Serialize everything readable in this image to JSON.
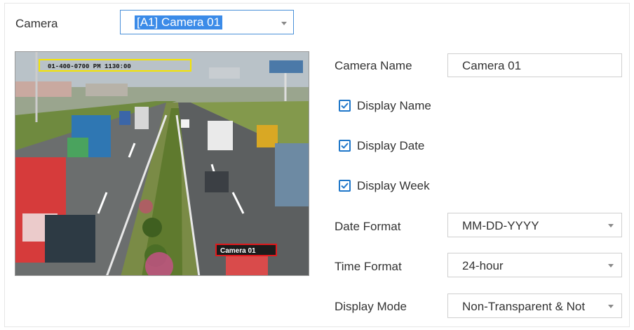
{
  "camera_selector": {
    "label": "Camera",
    "value": "[A1] Camera 01"
  },
  "preview": {
    "osd_date_text": "01-400-0700 PM 1130:00",
    "osd_name_text": "Camera 01",
    "osd_date_box_color": "#f5e400",
    "osd_name_box_color": "#e0191c"
  },
  "settings": {
    "camera_name": {
      "label": "Camera Name",
      "value": "Camera 01"
    },
    "display_name": {
      "label": "Display Name",
      "checked": true
    },
    "display_date": {
      "label": "Display Date",
      "checked": true
    },
    "display_week": {
      "label": "Display Week",
      "checked": true
    },
    "date_format": {
      "label": "Date Format",
      "value": "MM-DD-YYYY"
    },
    "time_format": {
      "label": "Time Format",
      "value": "24-hour"
    },
    "display_mode": {
      "label": "Display Mode",
      "value": "Non-Transparent & Not"
    }
  },
  "colors": {
    "accent": "#1f77c9",
    "selection": "#3b8be8",
    "border": "#cfcfcf"
  }
}
